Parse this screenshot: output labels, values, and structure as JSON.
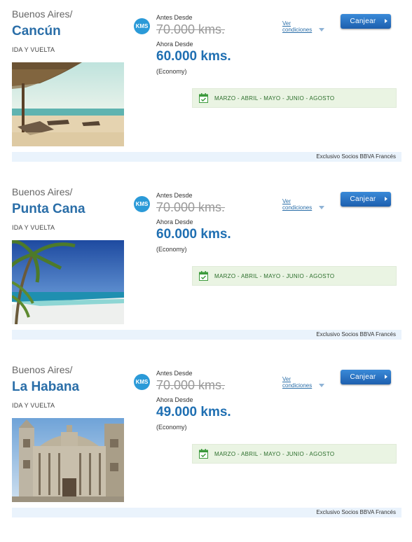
{
  "offers": [
    {
      "origin": "Buenos Aires/",
      "destination": "Cancún",
      "trip_type": "IDA Y VUELTA",
      "photo_icon": "beach-palapa-photo",
      "badge": "KMS",
      "before_label": "Antes Desde",
      "before_value": "70.000 kms.",
      "now_label": "Ahora Desde",
      "now_value": "60.000 kms.",
      "class": "(Economy)",
      "conditions": "Ver condiciones",
      "redeem": "Canjear",
      "months": "MARZO - ABRIL - MAYO - JUNIO - AGOSTO",
      "exclusive": "Exclusivo Socios BBVA Francés"
    },
    {
      "origin": "Buenos Aires/",
      "destination": "Punta Cana",
      "trip_type": "IDA Y VUELTA",
      "photo_icon": "palm-beach-photo",
      "badge": "KMS",
      "before_label": "Antes Desde",
      "before_value": "70.000 kms.",
      "now_label": "Ahora Desde",
      "now_value": "60.000 kms.",
      "class": "(Economy)",
      "conditions": "Ver condiciones",
      "redeem": "Canjear",
      "months": "MARZO - ABRIL - MAYO - JUNIO - AGOSTO",
      "exclusive": "Exclusivo Socios BBVA Francés"
    },
    {
      "origin": "Buenos Aires/",
      "destination": "La Habana",
      "trip_type": "IDA Y VUELTA",
      "photo_icon": "cathedral-photo",
      "badge": "KMS",
      "before_label": "Antes Desde",
      "before_value": "70.000 kms.",
      "now_label": "Ahora Desde",
      "now_value": "49.000 kms.",
      "class": "(Economy)",
      "conditions": "Ver condiciones",
      "redeem": "Canjear",
      "months": "MARZO - ABRIL - MAYO - JUNIO - AGOSTO",
      "exclusive": "Exclusivo Socios BBVA Francés"
    }
  ],
  "colors": {
    "link_blue": "#2a6ea8",
    "price_blue": "#1f6fb2",
    "badge_blue": "#2b9ad8",
    "months_green_bg": "#eaf4e3",
    "exclusive_bg": "#eaf3fc"
  }
}
